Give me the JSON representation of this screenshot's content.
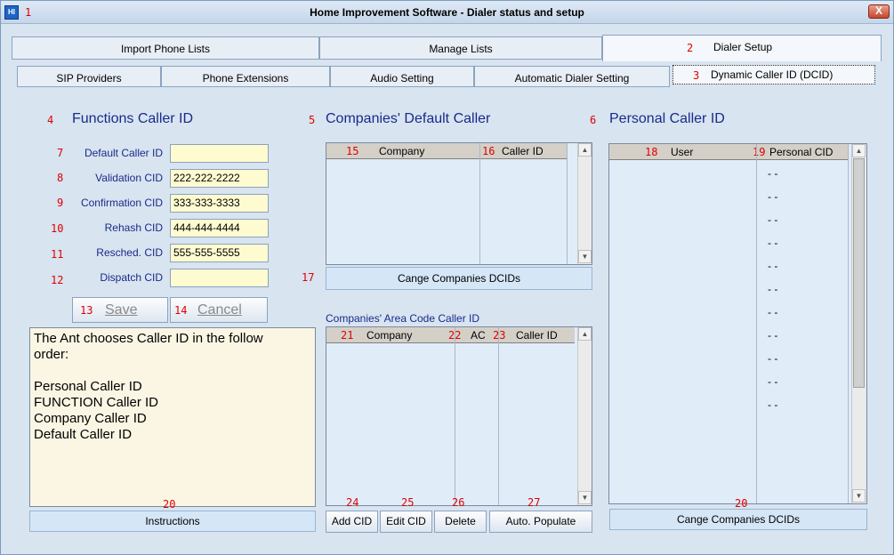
{
  "window": {
    "title": "Home Improvement Software - Dialer status and setup",
    "close_label": "X"
  },
  "markers": {
    "m1": "1",
    "m2": "2",
    "m3": "3",
    "m4": "4",
    "m5": "5",
    "m6": "6",
    "m7": "7",
    "m8": "8",
    "m9": "9",
    "m10": "10",
    "m11": "11",
    "m12": "12",
    "m13": "13",
    "m14": "14",
    "m15": "15",
    "m16": "16",
    "m17": "17",
    "m18": "18",
    "m19": "19",
    "m20a": "20",
    "m20b": "20",
    "m21": "21",
    "m22": "22",
    "m23": "23",
    "m24": "24",
    "m25": "25",
    "m26": "26",
    "m27": "27"
  },
  "tabs": {
    "import": "Import Phone Lists",
    "manage": "Manage Lists",
    "dialer": "Dialer Setup"
  },
  "subtabs": {
    "sip": "SIP Providers",
    "ext": "Phone Extensions",
    "audio": "Audio Setting",
    "auto": "Automatic Dialer Setting",
    "dcid": "Dynamic Caller ID (DCID)"
  },
  "functions": {
    "heading": "Functions Caller ID",
    "rows": [
      {
        "label": "Default Caller ID",
        "value": ""
      },
      {
        "label": "Validation CID",
        "value": "222-222-2222"
      },
      {
        "label": "Confirmation CID",
        "value": "333-333-3333"
      },
      {
        "label": "Rehash CID",
        "value": "444-444-4444"
      },
      {
        "label": "Resched. CID",
        "value": "555-555-5555"
      },
      {
        "label": "Dispatch CID",
        "value": ""
      }
    ],
    "save": "Save",
    "cancel": "Cancel"
  },
  "instructions": {
    "lines": [
      "The Ant chooses Caller ID in the follow",
      "order:",
      "",
      "Personal Caller ID",
      "FUNCTION Caller ID",
      "Company Caller ID",
      "Default Caller ID"
    ],
    "button": "Instructions"
  },
  "companies_default": {
    "heading": "Companies' Default Caller",
    "col_company": "Company",
    "col_callerid": "Caller ID",
    "button": "Cange Companies DCIDs"
  },
  "area_code": {
    "heading": "Companies' Area Code  Caller ID",
    "col_company": "Company",
    "col_ac": "AC",
    "col_callerid": "Caller ID",
    "btn_add": "Add CID",
    "btn_edit": "Edit CID",
    "btn_delete": "Delete",
    "btn_auto": "Auto. Populate"
  },
  "personal": {
    "heading": "Personal Caller ID",
    "col_user": "User",
    "col_cid": "Personal CID",
    "rows": [
      "-  -",
      "-  -",
      "-  -",
      "-  -",
      "-  -",
      "-  -",
      "-  -",
      "-  -",
      "-  -",
      "-  -",
      "-  -"
    ],
    "button": "Cange Companies DCIDs"
  }
}
